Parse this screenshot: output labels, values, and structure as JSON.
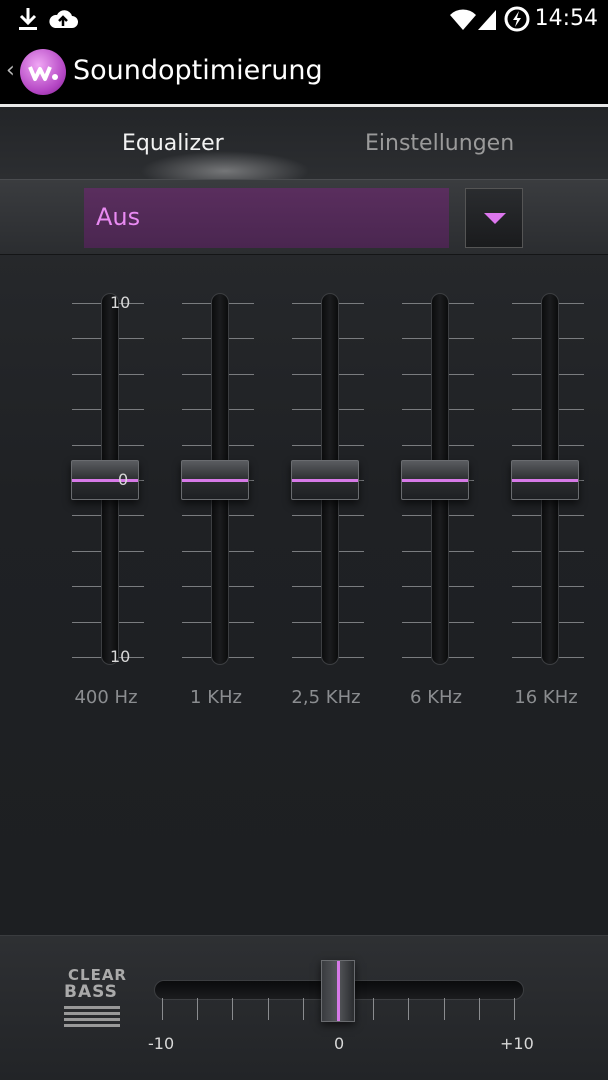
{
  "status_bar": {
    "time": "14:54",
    "icons": [
      "download-icon",
      "cloud-upload-icon",
      "wifi-icon",
      "signal-icon",
      "battery-charging-icon"
    ]
  },
  "action_bar": {
    "title": "Soundoptimierung",
    "logo_icon": "walkman-logo-icon",
    "back_icon": "chevron-left-icon"
  },
  "tabs": [
    {
      "label": "Equalizer",
      "selected": true
    },
    {
      "label": "Einstellungen",
      "selected": false
    }
  ],
  "preset": {
    "value": "Aus",
    "dropdown_icon": "triangle-down-icon"
  },
  "equalizer": {
    "scale_top": "10",
    "scale_mid": "0",
    "scale_bottom": "10",
    "bands": [
      {
        "label": "400 Hz",
        "level": 0
      },
      {
        "label": "1 KHz",
        "level": 0
      },
      {
        "label": "2,5 KHz",
        "level": 0
      },
      {
        "label": "6 KHz",
        "level": 0
      },
      {
        "label": "16 KHz",
        "level": 0
      }
    ]
  },
  "clear_bass": {
    "logo_line1": "CLEAR",
    "logo_line2": "BASS",
    "min_label": "-10",
    "mid_label": "0",
    "max_label": "+10",
    "value": 0
  },
  "colors": {
    "accent": "#d77ae8",
    "preset_background": "#4f2955",
    "preset_text": "#e98af2"
  }
}
